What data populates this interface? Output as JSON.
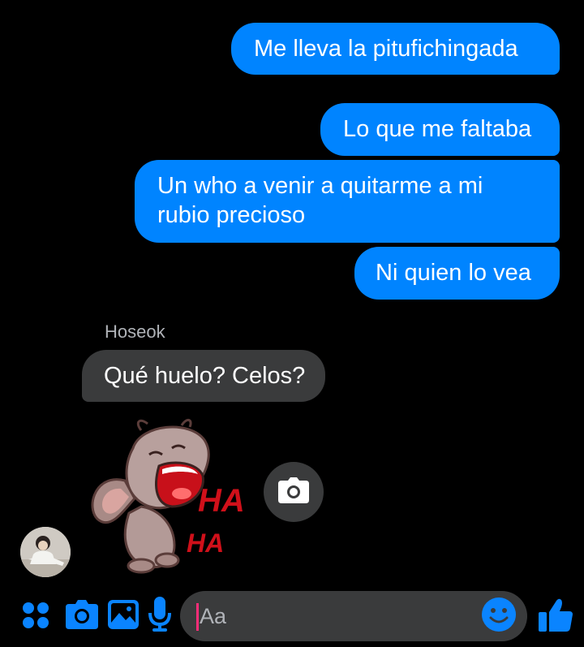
{
  "conversation": {
    "outgoing_messages": [
      {
        "text": "Me lleva la pitufichingada"
      },
      {
        "text": "Lo que me faltaba"
      },
      {
        "text": "Un who a venir a quitarme a mi",
        "text_line2": "rubio precioso"
      },
      {
        "text": "Ni quien lo vea"
      }
    ],
    "incoming": {
      "sender_name": "Hoseok",
      "message": "Qué huelo? Celos?",
      "sticker_text_1": "HA",
      "sticker_text_2": "HA"
    }
  },
  "composer": {
    "placeholder": "Aa",
    "icons": [
      "apps-icon",
      "camera-icon",
      "gallery-icon",
      "microphone-icon",
      "emoji-icon",
      "thumbs-up-icon"
    ]
  },
  "colors": {
    "accent": "#0084ff",
    "outgoing_bubble": "#0084ff",
    "incoming_bubble": "#3a3b3c",
    "background": "#000000",
    "caret": "#ff2d78"
  }
}
